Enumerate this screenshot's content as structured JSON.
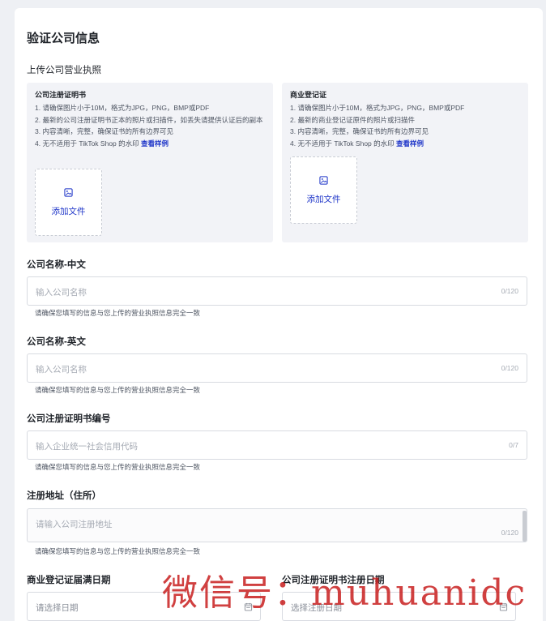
{
  "page": {
    "title": "验证公司信息",
    "upload_section_title": "上传公司营业执照"
  },
  "upload_cards": [
    {
      "title": "公司注册证明书",
      "requirements": [
        "1. 请确保图片小于10M，格式为JPG，PNG，BMP或PDF",
        "2. 最新的公司注册证明书正本的照片或扫描件，如丢失请提供认证后的副本",
        "3. 内容清晰，完整，确保证书的所有边界可见",
        "4. 无不适用于 TikTok Shop 的水印"
      ],
      "sample_link": "查看样例",
      "add_file_label": "添加文件"
    },
    {
      "title": "商业登记证",
      "requirements": [
        "1. 请确保图片小于10M，格式为JPG，PNG，BMP或PDF",
        "2. 最新的商业登记证原件的照片或扫描件",
        "3. 内容清晰，完整，确保证书的所有边界可见",
        "4. 无不适用于 TikTok Shop 的水印"
      ],
      "sample_link": "查看样例",
      "add_file_label": "添加文件"
    }
  ],
  "fields": {
    "company_name_cn": {
      "label": "公司名称-中文",
      "placeholder": "输入公司名称",
      "counter": "0/120",
      "hint": "请确保您填写的信息与您上传的营业执照信息完全一致"
    },
    "company_name_en": {
      "label": "公司名称-英文",
      "placeholder": "输入公司名称",
      "counter": "0/120",
      "hint": "请确保您填写的信息与您上传的营业执照信息完全一致"
    },
    "registration_number": {
      "label": "公司注册证明书编号",
      "placeholder": "输入企业统一社会信用代码",
      "counter": "0/7",
      "hint": "请确保您填写的信息与您上传的营业执照信息完全一致"
    },
    "registered_address": {
      "label": "注册地址（住所）",
      "placeholder": "请输入公司注册地址",
      "counter": "0/120",
      "hint": "请确保您填写的信息与您上传的营业执照信息完全一致"
    },
    "br_expiry_date": {
      "label": "商业登记证届满日期",
      "placeholder": "请选择日期"
    },
    "ci_registration_date": {
      "label": "公司注册证明书注册日期",
      "placeholder": "选择注册日期"
    }
  },
  "watermark": "微信号：muhuanidc",
  "colors": {
    "accent": "#1d34c8",
    "panel": "#f2f3f7"
  }
}
